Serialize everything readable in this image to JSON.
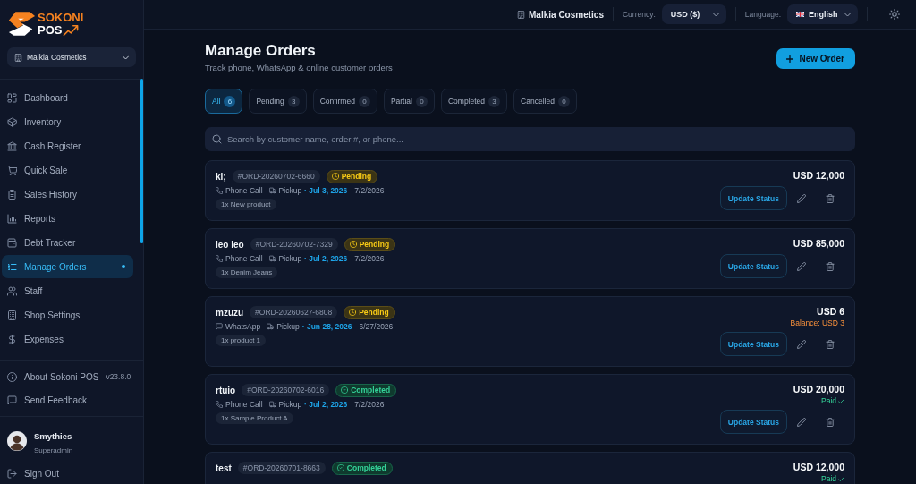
{
  "sidebar": {
    "logo": {
      "line_1": "SOKONI",
      "line_2": "POS"
    },
    "shop": "Malkia Cosmetics",
    "items": [
      {
        "label": "Dashboard",
        "selected": false
      },
      {
        "label": "Inventory",
        "selected": false
      },
      {
        "label": "Cash Register",
        "selected": false
      },
      {
        "label": "Quick Sale",
        "selected": false
      },
      {
        "label": "Sales History",
        "selected": false
      },
      {
        "label": "Reports",
        "selected": false
      },
      {
        "label": "Debt Tracker",
        "selected": false
      },
      {
        "label": "Manage Orders",
        "selected": true
      },
      {
        "label": "Staff",
        "selected": false
      },
      {
        "label": "Shop Settings",
        "selected": false
      },
      {
        "label": "Expenses",
        "selected": false
      }
    ],
    "footer_items": [
      {
        "label": "About Sokoni POS",
        "version": "v23.8.0"
      },
      {
        "label": "Send Feedback"
      }
    ],
    "user": {
      "name": "Smythies",
      "role": "Superadmin"
    },
    "sign_out": "Sign Out"
  },
  "header": {
    "shop": "Malkia Cosmetics",
    "currency": {
      "label": "Currency:",
      "value": "USD ($)"
    },
    "language": {
      "label": "Language:",
      "value": "English"
    }
  },
  "page": {
    "title": "Manage Orders",
    "subtitle": "Track phone, WhatsApp & online customer orders",
    "new_button": "New Order"
  },
  "tabs": [
    {
      "label": "All",
      "count": "6",
      "selected": true
    },
    {
      "label": "Pending",
      "count": "3",
      "selected": false
    },
    {
      "label": "Confirmed",
      "count": "0",
      "selected": false
    },
    {
      "label": "Partial",
      "count": "0",
      "selected": false
    },
    {
      "label": "Completed",
      "count": "3",
      "selected": false
    },
    {
      "label": "Cancelled",
      "count": "0",
      "selected": false
    }
  ],
  "search": {
    "placeholder": "Search by customer name, order #, or phone..."
  },
  "orders": [
    {
      "customer": "kl;",
      "number": "#ORD-20260702-6660",
      "status": {
        "label": "Pending",
        "kind": "pending"
      },
      "channel": {
        "label": "Phone Call",
        "kind": "phone"
      },
      "fulfillment": "Pickup",
      "due": "· Jul 3, 2026",
      "date": "7/2/2026",
      "items": [
        "1x New product"
      ],
      "total": "USD 12,000",
      "action": "Update Status"
    },
    {
      "customer": "leo leo",
      "number": "#ORD-20260702-7329",
      "status": {
        "label": "Pending",
        "kind": "pending"
      },
      "channel": {
        "label": "Phone Call",
        "kind": "phone"
      },
      "fulfillment": "Pickup",
      "due": "· Jul 2, 2026",
      "date": "7/2/2026",
      "items": [
        "1x Denim Jeans"
      ],
      "total": "USD 85,000",
      "action": "Update Status"
    },
    {
      "customer": "mzuzu",
      "number": "#ORD-20260627-6808",
      "status": {
        "label": "Pending",
        "kind": "pending"
      },
      "channel": {
        "label": "WhatsApp",
        "kind": "chat"
      },
      "fulfillment": "Pickup",
      "due": "· Jun 28, 2026",
      "date": "6/27/2026",
      "items": [
        "1x product 1"
      ],
      "total": "USD 6",
      "payment": {
        "label": "Balance: USD 3",
        "kind": "balance"
      },
      "action": "Update Status"
    },
    {
      "customer": "rtuio",
      "number": "#ORD-20260702-6016",
      "status": {
        "label": "Completed",
        "kind": "completed"
      },
      "channel": {
        "label": "Phone Call",
        "kind": "phone"
      },
      "fulfillment": "Pickup",
      "due": "· Jul 2, 2026",
      "date": "7/2/2026",
      "items": [
        "1x Sample Product A"
      ],
      "total": "USD 20,000",
      "payment": {
        "label": "Paid",
        "kind": "paid"
      },
      "action": "Update Status"
    },
    {
      "customer": "test",
      "number": "#ORD-20260701-8663",
      "status": {
        "label": "Completed",
        "kind": "completed"
      },
      "total": "USD 12,000",
      "payment": {
        "label": "Paid",
        "kind": "paid"
      }
    }
  ]
}
